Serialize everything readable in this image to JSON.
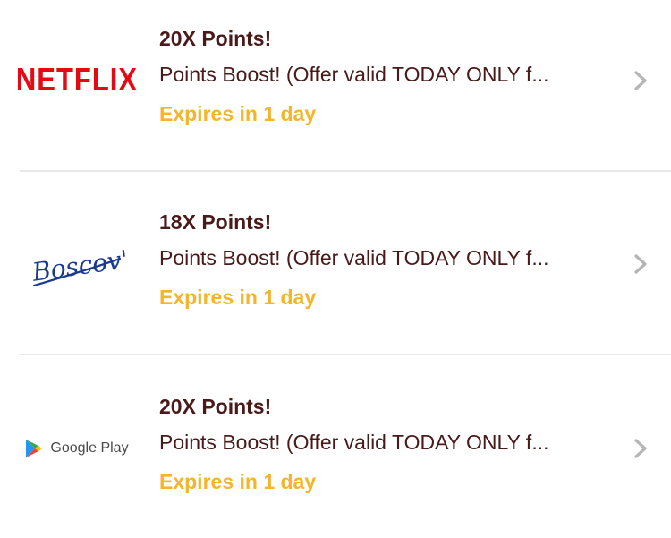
{
  "offers": [
    {
      "merchant_logo": "NETFLIX",
      "title": "20X Points!",
      "description": "Points Boost! (Offer valid TODAY ONLY f...",
      "expires": "Expires in 1 day"
    },
    {
      "merchant_logo": "Boscov's",
      "title": "18X Points!",
      "description": "Points Boost! (Offer valid TODAY ONLY f...",
      "expires": "Expires in 1 day"
    },
    {
      "merchant_logo": "Google Play",
      "title": "20X Points!",
      "description": "Points Boost! (Offer valid TODAY ONLY f...",
      "expires": "Expires in 1 day"
    }
  ],
  "colors": {
    "title_text": "#4a1a1a",
    "expires_text": "#f4b52d",
    "netflix_red": "#e50914",
    "boscovs_blue": "#1b3a8f",
    "divider": "#e8e8e8",
    "chevron": "#b5b5b5"
  },
  "icons": [
    "chevron-right-icon",
    "google-play-icon"
  ]
}
